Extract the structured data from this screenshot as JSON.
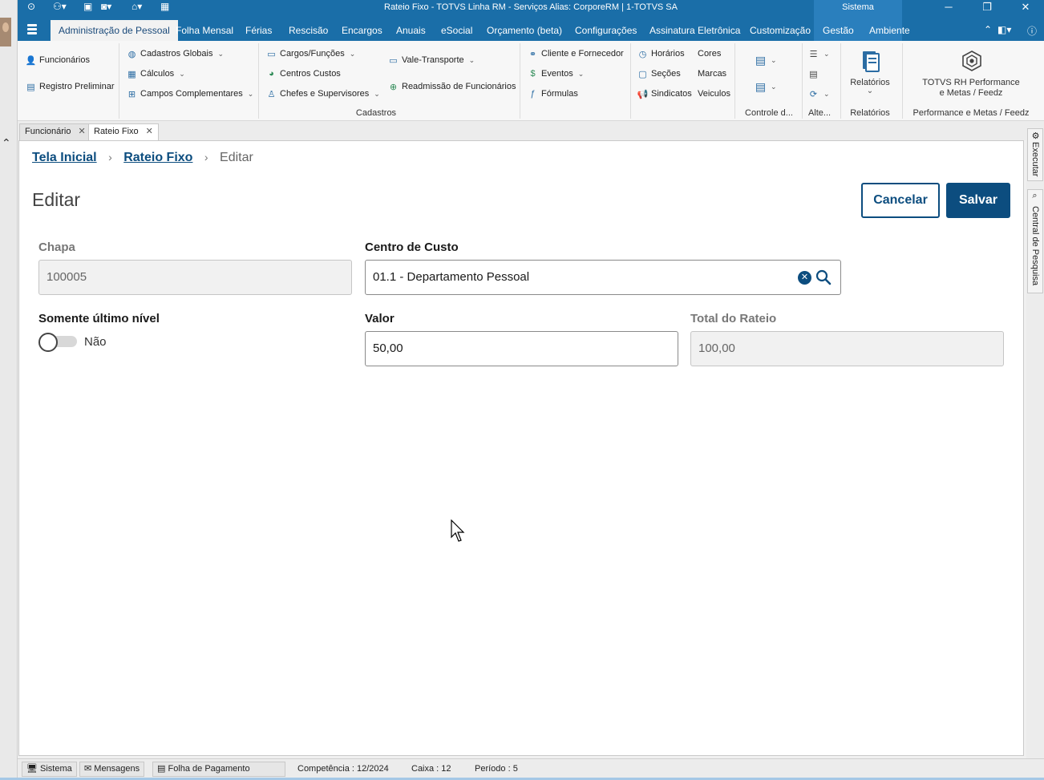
{
  "window": {
    "title": "Rateio Fixo - TOTVS Linha RM - Serviços  Alias: CorporeRM | 1-TOTVS SA",
    "system_label": "Sistema"
  },
  "menu": {
    "tabs": [
      {
        "label": "Administração de Pessoal",
        "active": true
      },
      {
        "label": "Folha Mensal"
      },
      {
        "label": "Férias"
      },
      {
        "label": "Rescisão"
      },
      {
        "label": "Encargos"
      },
      {
        "label": "Anuais"
      },
      {
        "label": "eSocial"
      },
      {
        "label": "Orçamento (beta)"
      },
      {
        "label": "Configurações"
      },
      {
        "label": "Assinatura Eletrônica"
      },
      {
        "label": "Customização"
      },
      {
        "label": "Gestão"
      },
      {
        "label": "Ambiente"
      }
    ]
  },
  "ribbon": {
    "items": {
      "funcionarios": "Funcionários",
      "registro_preliminar": "Registro Preliminar",
      "cadastros_globais": "Cadastros Globais",
      "calculos": "Cálculos",
      "campos_complementares": "Campos Complementares",
      "cargos_funcoes": "Cargos/Funções",
      "centros_custos": "Centros Custos",
      "chefes_supervisores": "Chefes e Supervisores",
      "vale_transporte": "Vale-Transporte",
      "readmissao": "Readmissão de Funcionários",
      "cliente_fornecedor": "Cliente e Fornecedor",
      "eventos": "Eventos",
      "formulas": "Fórmulas",
      "horarios": "Horários",
      "secoes": "Seções",
      "sindicatos": "Sindicatos",
      "cores": "Cores",
      "marcas": "Marcas",
      "veiculos": "Veiculos",
      "relatorios": "Relatórios",
      "performance_line1": "TOTVS RH Performance",
      "performance_line2": "e Metas / Feedz"
    },
    "groups": {
      "cadastros": "Cadastros",
      "controle": "Controle d...",
      "alte": "Alte...",
      "relatorios": "Relatórios",
      "performance": "Performance e Metas / Feedz"
    }
  },
  "doc_tabs": [
    {
      "label": "Funcionário"
    },
    {
      "label": "Rateio Fixo",
      "active": true
    }
  ],
  "breadcrumb": {
    "home": "Tela Inicial",
    "parent": "Rateio Fixo",
    "current": "Editar"
  },
  "page": {
    "title": "Editar",
    "cancel_label": "Cancelar",
    "save_label": "Salvar"
  },
  "form": {
    "chapa": {
      "label": "Chapa",
      "value": "100005"
    },
    "centro_custo": {
      "label": "Centro de Custo",
      "value": "01.1 - Departamento Pessoal"
    },
    "somente_ultimo_nivel": {
      "label": "Somente último nível",
      "state_text": "Não"
    },
    "valor": {
      "label": "Valor",
      "value": "50,00"
    },
    "total_rateio": {
      "label": "Total do Rateio",
      "value": "100,00"
    }
  },
  "side_panel": {
    "executar": "Executar",
    "central_pesquisa": "Central de Pesquisa"
  },
  "status_bar": {
    "sistema": "Sistema",
    "mensagens": "Mensagens",
    "folha_pagamento": "Folha de Pagamento",
    "competencia": "Competência : 12/2024",
    "caixa": "Caixa : 12",
    "periodo": "Período : 5"
  },
  "colors": {
    "titlebar": "#1a6ea8",
    "primary": "#0c4d7f",
    "accent_tab": "#2a7fbd"
  }
}
